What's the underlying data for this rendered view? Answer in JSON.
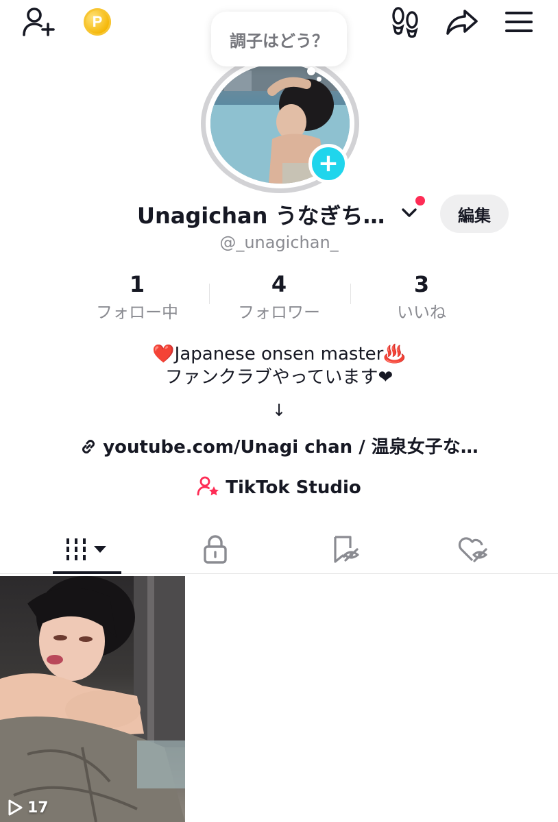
{
  "header": {
    "add_friend_icon": "person-add-icon",
    "coin_icon": "coin-icon",
    "coin_letter": "P",
    "footprints_icon": "footprints-icon",
    "share_icon": "share-icon",
    "menu_icon": "hamburger-menu-icon"
  },
  "status_bubble": {
    "text": "調子はどう？"
  },
  "profile": {
    "display_name": "Unagichan うなぎち…",
    "username": "@_unagichan_",
    "edit_label": "編集"
  },
  "stats": [
    {
      "value": "1",
      "label": "フォロー中"
    },
    {
      "value": "4",
      "label": "フォロワー"
    },
    {
      "value": "3",
      "label": "いいね"
    }
  ],
  "bio": {
    "line1": "❤️Japanese onsen master♨️",
    "line2": "ファンクラブやっています❤",
    "line3": "↓"
  },
  "link": {
    "text": "youtube.com/Unagi chan / 温泉女子な…"
  },
  "studio": {
    "label": "TikTok Studio"
  },
  "tabs": [
    {
      "name": "videos",
      "icon": "grid-icon",
      "active": true
    },
    {
      "name": "private",
      "icon": "lock-icon",
      "active": false
    },
    {
      "name": "saved",
      "icon": "bookmark-hidden-icon",
      "active": false
    },
    {
      "name": "liked",
      "icon": "heart-hidden-icon",
      "active": false
    }
  ],
  "videos": [
    {
      "plays": "17"
    }
  ],
  "colors": {
    "accent_cyan": "#20d5ec",
    "accent_red": "#fe2c55",
    "text_primary": "#161823",
    "text_secondary": "#8a8b91"
  }
}
